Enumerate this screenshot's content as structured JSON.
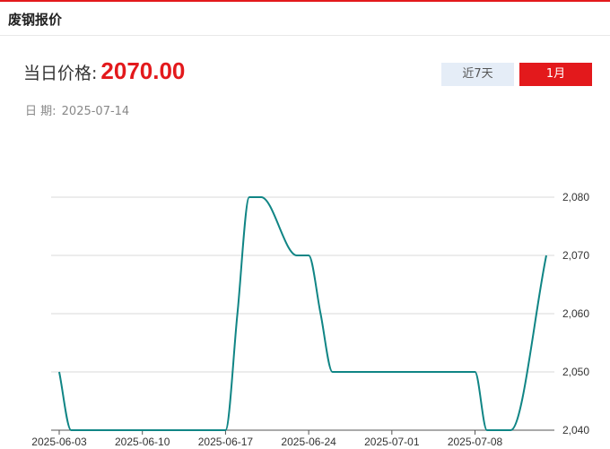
{
  "header": {
    "title": "废钢报价"
  },
  "price": {
    "label": "当日价格:",
    "value": "2070.00"
  },
  "date": {
    "label": "日 期:",
    "value": "2025-07-14"
  },
  "range_buttons": [
    {
      "label": "近7天",
      "active": false
    },
    {
      "label": "1月",
      "active": true
    }
  ],
  "colors": {
    "accent": "#e3191c",
    "line": "#108585"
  },
  "chart_data": {
    "type": "line",
    "title": "",
    "xlabel": "",
    "ylabel": "",
    "ylim": [
      2040,
      2080
    ],
    "yticks": [
      2040,
      2050,
      2060,
      2070,
      2080
    ],
    "ytick_labels": [
      "2,040",
      "2,050",
      "2,060",
      "2,070",
      "2,080"
    ],
    "xticks": [
      "2025-06-03",
      "2025-06-10",
      "2025-06-17",
      "2025-06-24",
      "2025-07-01",
      "2025-07-08"
    ],
    "grid": true,
    "series": [
      {
        "name": "",
        "x": [
          "2025-06-03",
          "2025-06-04",
          "2025-06-05",
          "2025-06-06",
          "2025-06-09",
          "2025-06-10",
          "2025-06-11",
          "2025-06-12",
          "2025-06-13",
          "2025-06-16",
          "2025-06-17",
          "2025-06-18",
          "2025-06-19",
          "2025-06-20",
          "2025-06-23",
          "2025-06-24",
          "2025-06-25",
          "2025-06-26",
          "2025-06-27",
          "2025-06-30",
          "2025-07-01",
          "2025-07-02",
          "2025-07-03",
          "2025-07-04",
          "2025-07-07",
          "2025-07-08",
          "2025-07-09",
          "2025-07-10",
          "2025-07-11",
          "2025-07-14"
        ],
        "values": [
          2050,
          2040,
          2040,
          2040,
          2040,
          2040,
          2040,
          2040,
          2040,
          2040,
          2040,
          2060,
          2080,
          2080,
          2070,
          2070,
          2060,
          2050,
          2050,
          2050,
          2050,
          2050,
          2050,
          2050,
          2050,
          2050,
          2040,
          2040,
          2040,
          2070
        ]
      }
    ]
  }
}
